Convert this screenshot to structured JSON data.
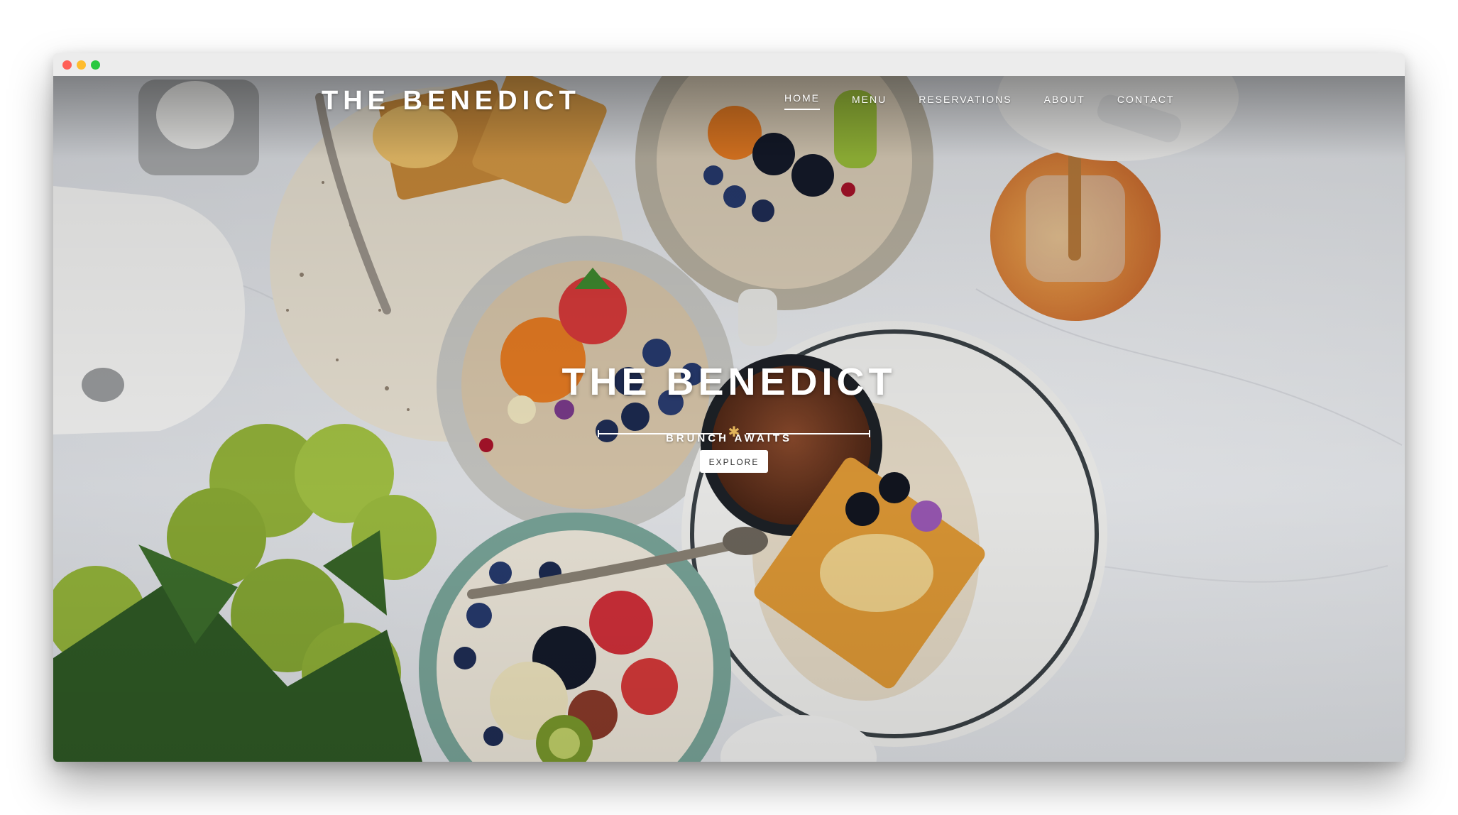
{
  "window": {
    "controls": [
      "close",
      "minimize",
      "maximize"
    ]
  },
  "colors": {
    "close": "#ff5f57",
    "minimize": "#febc2e",
    "maximize": "#28c840",
    "accent_star": "#e2b45a"
  },
  "header": {
    "brand": "THE BENEDICT",
    "nav": [
      {
        "label": "HOME",
        "active": true
      },
      {
        "label": "MENU",
        "active": false
      },
      {
        "label": "RESERVATIONS",
        "active": false
      },
      {
        "label": "ABOUT",
        "active": false
      },
      {
        "label": "CONTACT",
        "active": false
      }
    ]
  },
  "hero": {
    "title": "THE BENEDICT",
    "divider_icon": "asterisk-icon",
    "subtitle": "BRUNCH AWAITS",
    "cta_label": "EXPLORE"
  }
}
